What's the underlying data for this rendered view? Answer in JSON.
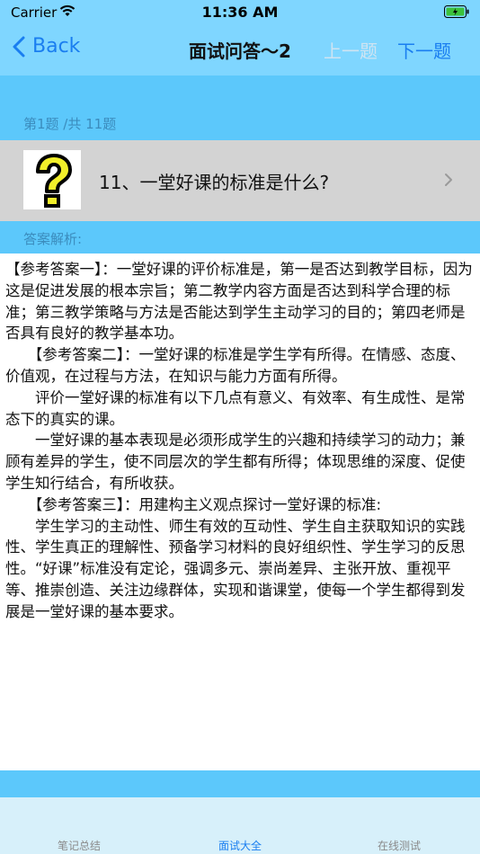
{
  "status": {
    "carrier": "Carrier",
    "time": "11:36 AM"
  },
  "nav": {
    "back_label": "Back",
    "title": "面试问答～2",
    "prev_label": "上一题",
    "next_label": "下一题"
  },
  "question": {
    "counter": "第1题 /共 11题",
    "text": "11、一堂好课的标准是什么?"
  },
  "answer": {
    "label": "答案解析:",
    "paragraphs": [
      "【参考答案一】：一堂好课的评价标准是，第一是否达到教学目标，因为这是促进发展的根本宗旨；第二教学内容方面是否达到科学合理的标准；第三教学策略与方法是否能达到学生主动学习的目的；第四老师是否具有良好的教学基本功。",
      "　　【参考答案二】：一堂好课的标准是学生学有所得。在情感、态度、价值观，在过程与方法，在知识与能力方面有所得。",
      "　　评价一堂好课的标准有以下几点有意义、有效率、有生成性、是常态下的真实的课。",
      "　　一堂好课的基本表现是必须形成学生的兴趣和持续学习的动力；兼顾有差异的学生，使不同层次的学生都有所得；体现思维的深度、促使学生知行结合，有所收获。",
      "　　【参考答案三】：用建构主义观点探讨一堂好课的标准:",
      "　　学生学习的主动性、师生有效的互动性、学生自主获取知识的实践性、学生真正的理解性、预备学习材料的良好组织性、学生学习的反思性。“好课”标准没有定论，强调多元、崇尚差异、主张开放、重视平等、推崇创造、关注边缘群体，实现和谐课堂，使每一个学生都得到发展是一堂好课的基本要求。"
    ]
  },
  "tabs": {
    "notes": "笔记总结",
    "interview": "面试大全",
    "test": "在线测试"
  },
  "colors": {
    "accent": "#1a7ef0",
    "nav_bg": "#7fd6ff",
    "band_bg": "#5cc8fb",
    "tab_bg": "#d7f0fa"
  }
}
